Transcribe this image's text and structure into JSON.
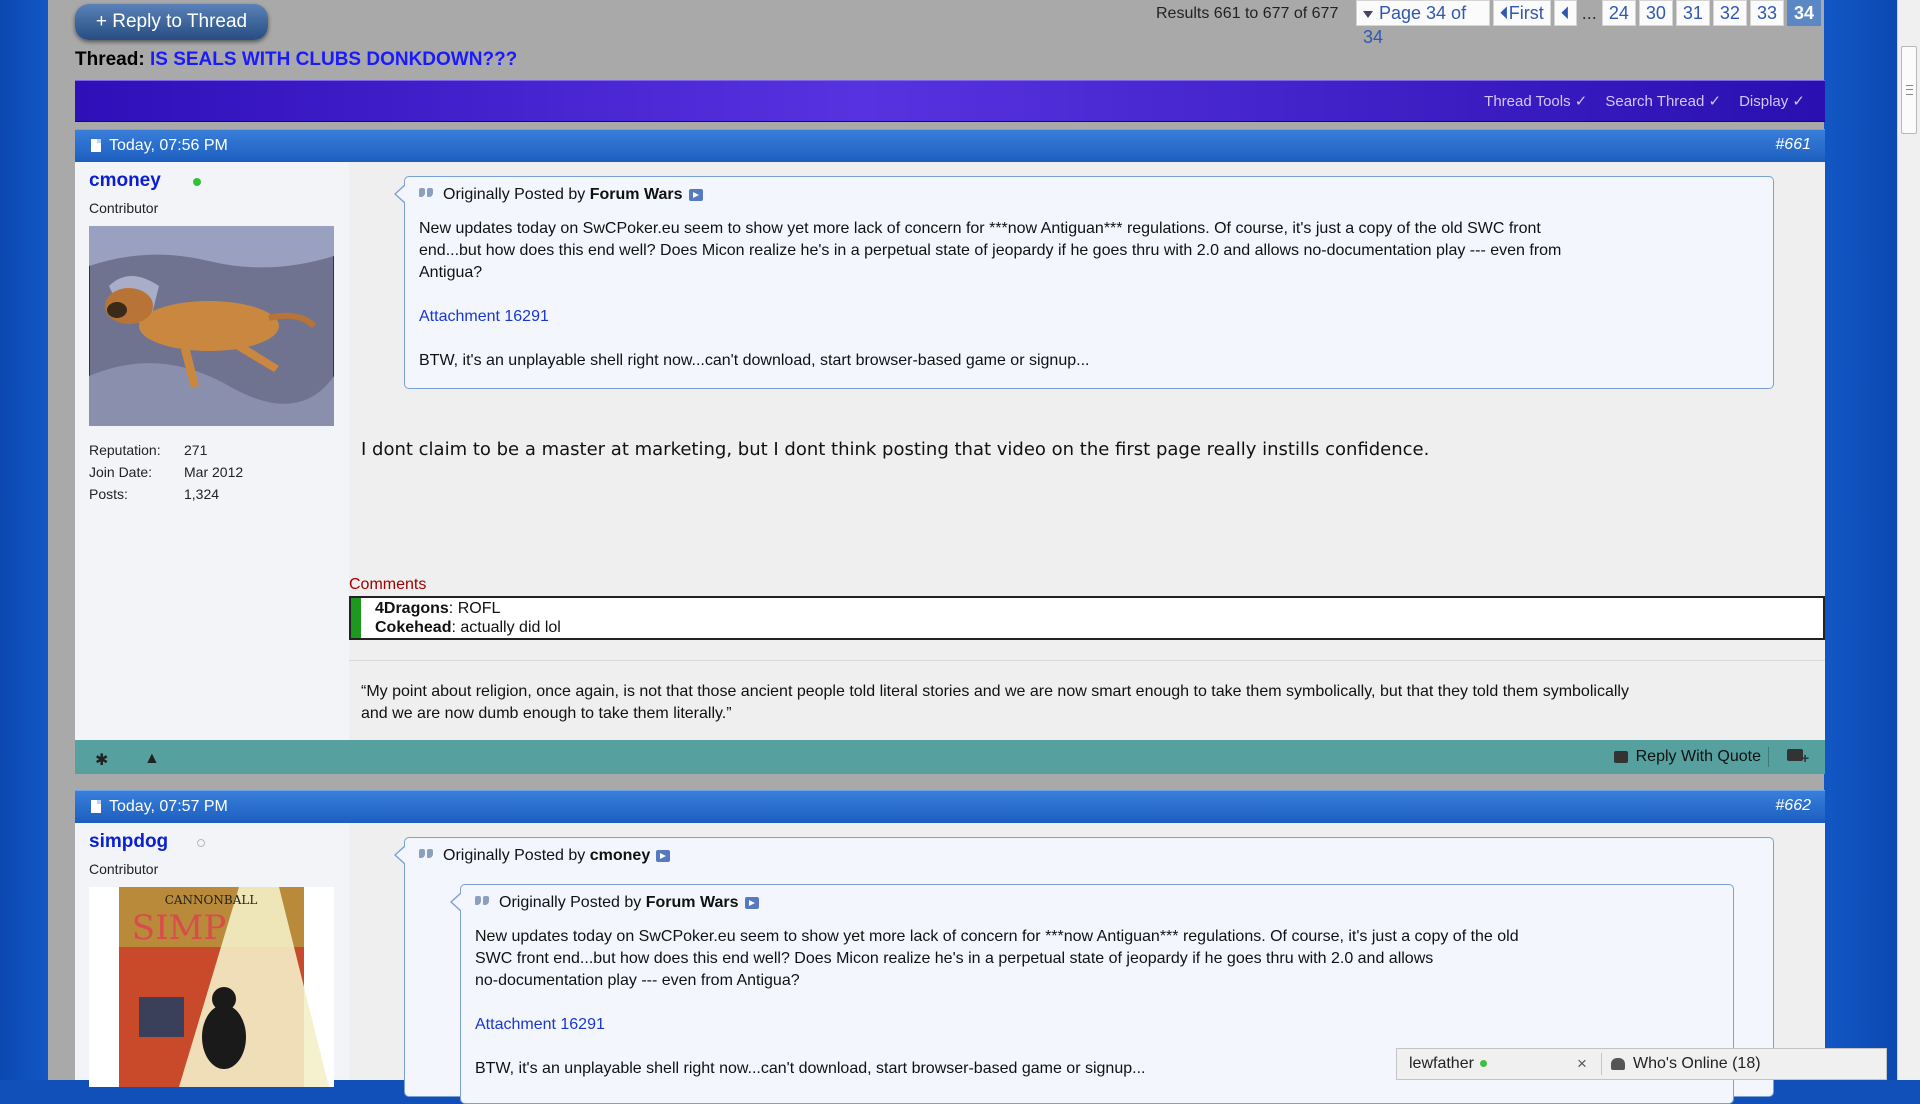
{
  "header": {
    "reply_button": "+ Reply to Thread",
    "results": "Results 661 to 677 of 677",
    "pagination": {
      "page_label": "Page 34 of 34",
      "first": "First",
      "dots": "...",
      "pages": [
        "24",
        "30",
        "31",
        "32",
        "33"
      ],
      "current": "34"
    },
    "thread_prefix": "Thread:",
    "thread_title": "IS SEALS WITH CLUBS DONKDOWN???"
  },
  "toolbar": {
    "thread_tools": "Thread Tools",
    "search_thread": "Search Thread",
    "display": "Display"
  },
  "posts": [
    {
      "date": "Today, 07:56 PM",
      "number": "#661",
      "username": "cmoney",
      "online": true,
      "user_title": "Contributor",
      "stats": {
        "reputation_label": "Reputation:",
        "reputation": "271",
        "join_label": "Join Date:",
        "join": "Mar 2012",
        "posts_label": "Posts:",
        "posts": "1,324"
      },
      "quote": {
        "prefix": "Originally Posted by",
        "author": "Forum Wars",
        "line1": "New updates today on SwCPoker.eu seem to show yet more lack of concern for ***now Antiguan*** regulations. Of course, it's just a copy of the old SWC front",
        "line2": "end...but how does this end well? Does Micon realize he's in a perpetual state of jeopardy if he goes thru with 2.0 and allows no-documentation play --- even from",
        "line3": "Antigua?",
        "attachment": "Attachment 16291",
        "closing": "BTW, it's an unplayable shell right now...can't download, start browser-based game or signup..."
      },
      "message": "I dont claim to be a master at marketing, but I dont think posting that video on the first page really instills confidence.",
      "comments_label": "Comments",
      "comments": [
        {
          "user": "4Dragons",
          "text": ": ROFL"
        },
        {
          "user": "Cokehead",
          "text": ": actually did lol"
        }
      ],
      "signature_line1": "“My point about religion, once again, is not that those ancient people told literal stories and we are now smart enough to take them symbolically, but that they told them symbolically",
      "signature_line2": "and we are now dumb enough to take them literally.”",
      "reply_with_quote": "Reply With Quote"
    },
    {
      "date": "Today, 07:57 PM",
      "number": "#662",
      "username": "simpdog",
      "online": false,
      "user_title": "Contributor",
      "avatar_text_1": "CANNONBALL",
      "avatar_text_2": "SIMP",
      "quote": {
        "prefix": "Originally Posted by",
        "author": "cmoney"
      },
      "inner_quote": {
        "prefix": "Originally Posted by",
        "author": "Forum Wars",
        "line1": "New updates today on SwCPoker.eu seem to show yet more lack of concern for ***now Antiguan*** regulations. Of course, it's just a copy of the old",
        "line2": "SWC front end...but how does this end well? Does Micon realize he's in a perpetual state of jeopardy if he goes thru with 2.0 and allows",
        "line3": "no-documentation play --- even from Antigua?",
        "attachment": "Attachment 16291",
        "closing": "BTW, it's an unplayable shell right now...can't download, start browser-based game or signup..."
      }
    }
  ],
  "chatbar": {
    "user": "lewfather",
    "close": "×",
    "whos_online": "Who's Online (18)"
  },
  "colors": {
    "post_header": "#1c5ec0",
    "toolbar": "#4a2bd8",
    "post_footer": "#57a0a0",
    "username": "#0a1fd0",
    "thread_title": "#1a1aff"
  }
}
